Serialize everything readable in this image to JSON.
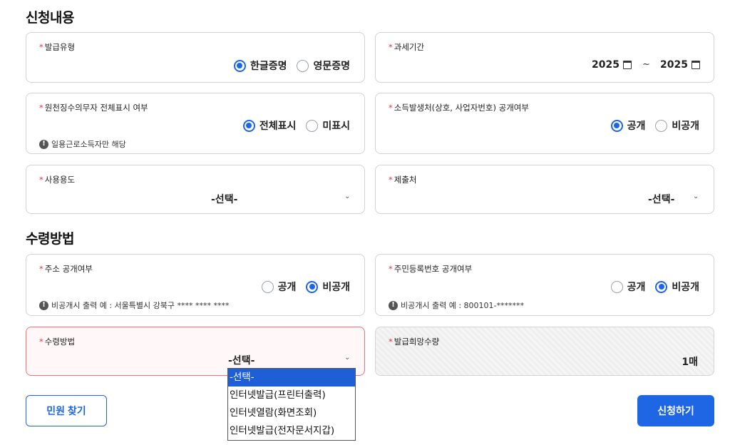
{
  "section1": {
    "title": "신청내용"
  },
  "issue_type": {
    "label": "발급유형",
    "options": [
      "한글증명",
      "영문증명"
    ],
    "selected": "한글증명"
  },
  "tax_period": {
    "label": "과세기간",
    "from": "2025",
    "sep": "~",
    "to": "2025"
  },
  "withholding": {
    "label": "원천징수의무자 전체표시 여부",
    "options": [
      "전체표시",
      "미표시"
    ],
    "selected": "전체표시",
    "note": "일용근로소득자만 해당"
  },
  "income_source": {
    "label": "소득발생처(상호, 사업자번호) 공개여부",
    "options": [
      "공개",
      "비공개"
    ],
    "selected": "공개"
  },
  "usage": {
    "label": "사용용도",
    "value": "-선택-"
  },
  "submit_to": {
    "label": "제출처",
    "value": "-선택-"
  },
  "section2": {
    "title": "수령방법"
  },
  "address": {
    "label": "주소 공개여부",
    "options": [
      "공개",
      "비공개"
    ],
    "selected": "비공개",
    "note": "비공개시 출력 예 : 서울특별시 강북구 **** **** ****"
  },
  "resident_no": {
    "label": "주민등록번호 공개여부",
    "options": [
      "공개",
      "비공개"
    ],
    "selected": "비공개",
    "note": "비공개시 출력 예 : 800101-*******"
  },
  "receive_method": {
    "label": "수령방법",
    "value": "-선택-",
    "dropdown_options": [
      "-선택-",
      "인터넷발급(프린터출력)",
      "인터넷열람(화면조회)",
      "인터넷발급(전자문서지갑)"
    ],
    "highlighted": "-선택-"
  },
  "quantity": {
    "label": "발급희망수량",
    "value": "1매"
  },
  "buttons": {
    "find": "민원 찾기",
    "apply": "신청하기"
  },
  "colors": {
    "accent": "#1f66e5",
    "required": "#e0343f",
    "error_border": "#f2707c"
  },
  "icons": {
    "required": "*",
    "note": "!",
    "chevron": "⌄"
  }
}
